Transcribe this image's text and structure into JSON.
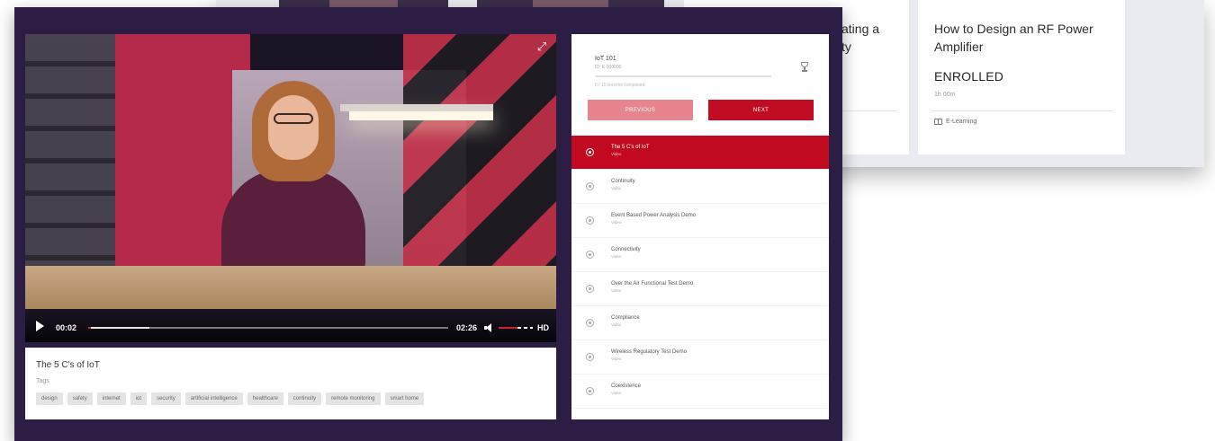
{
  "background_catalog": {
    "cards": [
      {
        "title": "ating a\nty",
        "status": "",
        "duration": "",
        "kind": ""
      },
      {
        "title": "How to Design an RF Power Amplifier",
        "status": "ENROLLED",
        "duration": "1h 00m",
        "kind": "E-Learning",
        "kind_icon": "book-icon"
      }
    ]
  },
  "video": {
    "current_time": "00:02",
    "total_time": "02:26",
    "progress_fraction": 0.007,
    "buffered_fraction": 0.17,
    "volume_fraction": 0.55,
    "quality_label": "HD",
    "icons": {
      "play": "play-icon",
      "fullscreen": "fullscreen-icon",
      "volume": "volume-icon"
    }
  },
  "info": {
    "title": "The 5 C's of IoT",
    "tags_label": "Tags",
    "tags": [
      "design",
      "safety",
      "internet",
      "iot",
      "security",
      "artificial intelligence",
      "healthcare",
      "continuity",
      "remote monitoring",
      "smart home"
    ]
  },
  "panel": {
    "course_title": "IoT 101",
    "course_id": "ID: E-000000",
    "progress_text": "0 / 10 lessons completed",
    "progress_fraction": 0.0,
    "trophy_icon": "trophy-icon",
    "previous_label": "PREVIOUS",
    "next_label": "NEXT",
    "lessons": [
      {
        "title": "The 5 C's of IoT",
        "type": "Video",
        "active": true
      },
      {
        "title": "Continuity",
        "type": "Video",
        "active": false
      },
      {
        "title": "Event Based Power Analysis Demo",
        "type": "Video",
        "active": false
      },
      {
        "title": "Connectivity",
        "type": "Video",
        "active": false
      },
      {
        "title": "Over the Air Functional Test Demo",
        "type": "Video",
        "active": false
      },
      {
        "title": "Compliance",
        "type": "Video",
        "active": false
      },
      {
        "title": "Wireless Regulatory Test Demo",
        "type": "Video",
        "active": false
      },
      {
        "title": "Coexistence",
        "type": "Video",
        "active": false
      }
    ]
  },
  "colors": {
    "modal_bg": "#2c1d45",
    "accent_red": "#c10a1f",
    "prev_button": "#e8848e"
  }
}
